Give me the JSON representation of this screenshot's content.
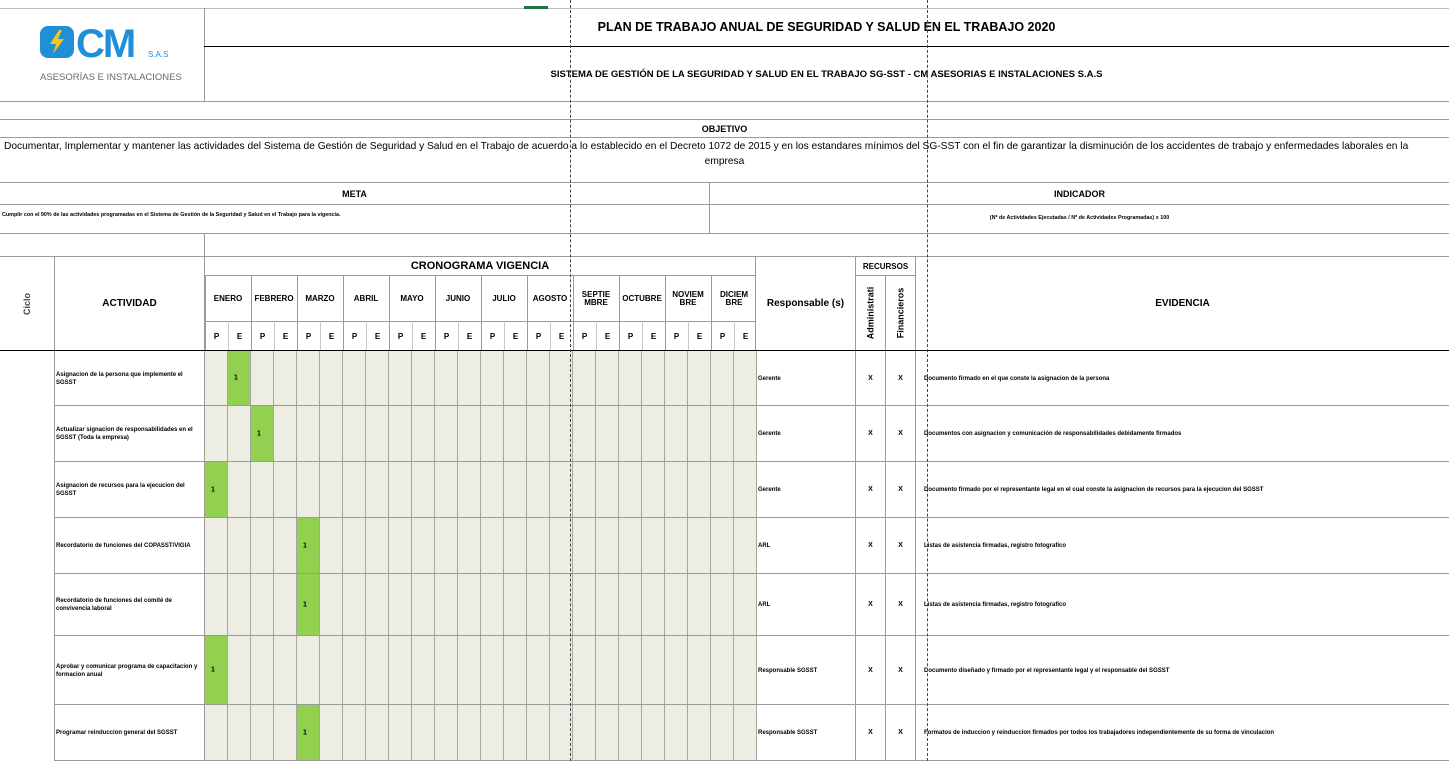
{
  "company": {
    "logo_text": "CM",
    "logo_suffix": "S.A.S",
    "logo_tagline": "ASESORÍAS E INSTALACIONES",
    "brand_blue": "#1f8fd8",
    "brand_yellow": "#f5c518"
  },
  "header": {
    "title": "PLAN DE TRABAJO ANUAL DE SEGURIDAD Y SALUD EN EL TRABAJO 2020",
    "subtitle": "SISTEMA DE GESTIÓN DE LA SEGURIDAD Y SALUD EN EL TRABAJO SG-SST - CM ASESORIAS E INSTALACIONES S.A.S"
  },
  "objective": {
    "label": "OBJETIVO",
    "text": "Documentar, Implementar y mantener las actividades del Sistema de Gestión de Seguridad y Salud en el Trabajo de acuerdo a lo establecido en el Decreto 1072 de 2015 y en los estandares mínimos del SG-SST  con el fin de garantizar la disminución de los accidentes de trabajo y enfermedades laborales en la empresa",
    "text_line1": "Documentar, Implementar y mantener las actividades del Sistema de Gestión de Seguridad y Salud en el Trabajo de acuerdo a lo establecido en el Decreto 1072 de 2015 y en los estandares mínimos del SG-SST  con el fin de garantizar la disminución de los accidentes de trabajo y enfermedades laborales en la",
    "text_line2": "empresa"
  },
  "meta": {
    "label": "META",
    "text": "Cumplir con el 90% de las actividades programadas en el Sistema de Gestión de la Seguridad y Salud en el Trabajo para la vigencia."
  },
  "indicador": {
    "label": "INDICADOR",
    "text": "(Nº de Actividades Ejecutadas / Nº de Actividades Programadas) x 100"
  },
  "table": {
    "ciclo_label": "Ciclo",
    "actividad_label": "ACTIVIDAD",
    "cronograma_label": "CRONOGRAMA VIGENCIA",
    "responsable_label": "Responsable (s)",
    "recursos_label": "RECURSOS",
    "administrativos_label": "Administrati",
    "financieros_label": "Financieros",
    "evidencia_label": "EVIDENCIA",
    "months": [
      {
        "l1": "ENERO",
        "l2": ""
      },
      {
        "l1": "FEBRERO",
        "l2": ""
      },
      {
        "l1": "MARZO",
        "l2": ""
      },
      {
        "l1": "ABRIL",
        "l2": ""
      },
      {
        "l1": "MAYO",
        "l2": ""
      },
      {
        "l1": "JUNIO",
        "l2": ""
      },
      {
        "l1": "JULIO",
        "l2": ""
      },
      {
        "l1": "AGOSTO",
        "l2": ""
      },
      {
        "l1": "SEPTIE",
        "l2": "MBRE"
      },
      {
        "l1": "OCTUBRE",
        "l2": ""
      },
      {
        "l1": "NOVIEM",
        "l2": "BRE"
      },
      {
        "l1": "DICIEM",
        "l2": "BRE"
      }
    ],
    "p_label": "P",
    "e_label": "E",
    "marked_colors": {
      "on": "#92d050",
      "off": "#eeede3"
    },
    "rows": [
      {
        "actividad": "Asignacion de la persona que implemente el SGSST",
        "mark_col": 1,
        "mark_value": "1",
        "responsable": "Gerente",
        "admin": "X",
        "fin": "X",
        "evidencia": "Documento firmado en el que conste la asignacion de la persona"
      },
      {
        "actividad": "Actualizar signacion de responsabilidades en el SGSST (Toda la empresa)",
        "mark_col": 2,
        "mark_value": "1",
        "responsable": "Gerente",
        "admin": "X",
        "fin": "X",
        "evidencia": "Documentos con asignacion y comunicación de responsabilidades debidamente firmados"
      },
      {
        "actividad": "Asignacion de recursos para la ejecucion del SGSST",
        "mark_col": 0,
        "mark_value": "1",
        "responsable": "Gerente",
        "admin": "X",
        "fin": "X",
        "evidencia": "Documento firmado por el representante legal en el cual conste la asignacion de recursos para la ejecucion del SGSST"
      },
      {
        "actividad": "Recordatorio de funciones del COPASST/VIGIA",
        "mark_col": 4,
        "mark_value": "1",
        "responsable": "ARL",
        "admin": "X",
        "fin": "X",
        "evidencia": "Listas de asistencia firmadas, registro fotografico"
      },
      {
        "actividad": "Recordatorio de funciones del comité de convivencia laboral",
        "mark_col": 4,
        "mark_value": "1",
        "responsable": "ARL",
        "admin": "X",
        "fin": "X",
        "evidencia": "Listas de asistencia firmadas, registro fotografico"
      },
      {
        "actividad": "Aprobar y comunicar programa de capacitacion y formacion anual",
        "mark_col": 0,
        "mark_value": "1",
        "responsable": "Responsable SGSST",
        "admin": "X",
        "fin": "X",
        "evidencia": "Documento diseñado y firmado por el representante legal y el responsable del SGSST"
      },
      {
        "actividad": "Programar reinduccion general del SGSST",
        "mark_col": 4,
        "mark_value": "1",
        "responsable": "Responsable SGSST",
        "admin": "X",
        "fin": "X",
        "evidencia": "Formatos de induccion y reinduccion firmados por todos los trabajadores independientemente de su forma de vinculacion"
      }
    ]
  }
}
